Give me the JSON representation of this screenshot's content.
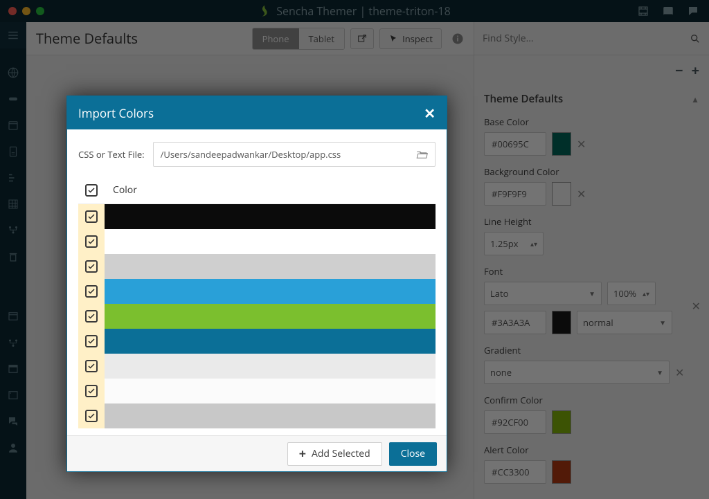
{
  "window": {
    "title": "Sencha Themer | theme-triton-18"
  },
  "toolbar": {
    "page_title": "Theme Defaults",
    "phone_label": "Phone",
    "tablet_label": "Tablet",
    "inspect_label": "Inspect"
  },
  "find": {
    "placeholder": "Find Style…"
  },
  "rightpanel": {
    "header": "Theme Defaults",
    "base_color": {
      "label": "Base Color",
      "value": "#00695C",
      "swatch": "#00695C"
    },
    "background_color": {
      "label": "Background Color",
      "value": "#F9F9F9",
      "swatch": "#F9F9F9"
    },
    "line_height": {
      "label": "Line Height",
      "value": "1.25px"
    },
    "font": {
      "label": "Font",
      "family": "Lato",
      "size": "100%",
      "color_value": "#3A3A3A",
      "color_swatch": "#1a1a1a",
      "style": "normal"
    },
    "gradient": {
      "label": "Gradient",
      "value": "none"
    },
    "confirm_color": {
      "label": "Confirm Color",
      "value": "#92CF00",
      "swatch": "#86B80A"
    },
    "alert_color": {
      "label": "Alert Color",
      "value": "#CC3300",
      "swatch": "#B73A12"
    }
  },
  "modal": {
    "title": "Import Colors",
    "file_label": "CSS or Text File:",
    "file_path": "/Users/sandeepadwankar/Desktop/app.css",
    "color_header": "Color",
    "rows": [
      {
        "checked": true,
        "color": "#0b0b0b"
      },
      {
        "checked": true,
        "color": "#ffffff"
      },
      {
        "checked": true,
        "color": "#cfcfcf"
      },
      {
        "checked": true,
        "color": "#29a0d8"
      },
      {
        "checked": true,
        "color": "#7bbf2e"
      },
      {
        "checked": true,
        "color": "#0b6f97"
      },
      {
        "checked": true,
        "color": "#eaeaea"
      },
      {
        "checked": true,
        "color": "#fbfbfb"
      },
      {
        "checked": true,
        "color": "#c8c8c8"
      }
    ],
    "add_label": "Add Selected",
    "close_label": "Close"
  }
}
